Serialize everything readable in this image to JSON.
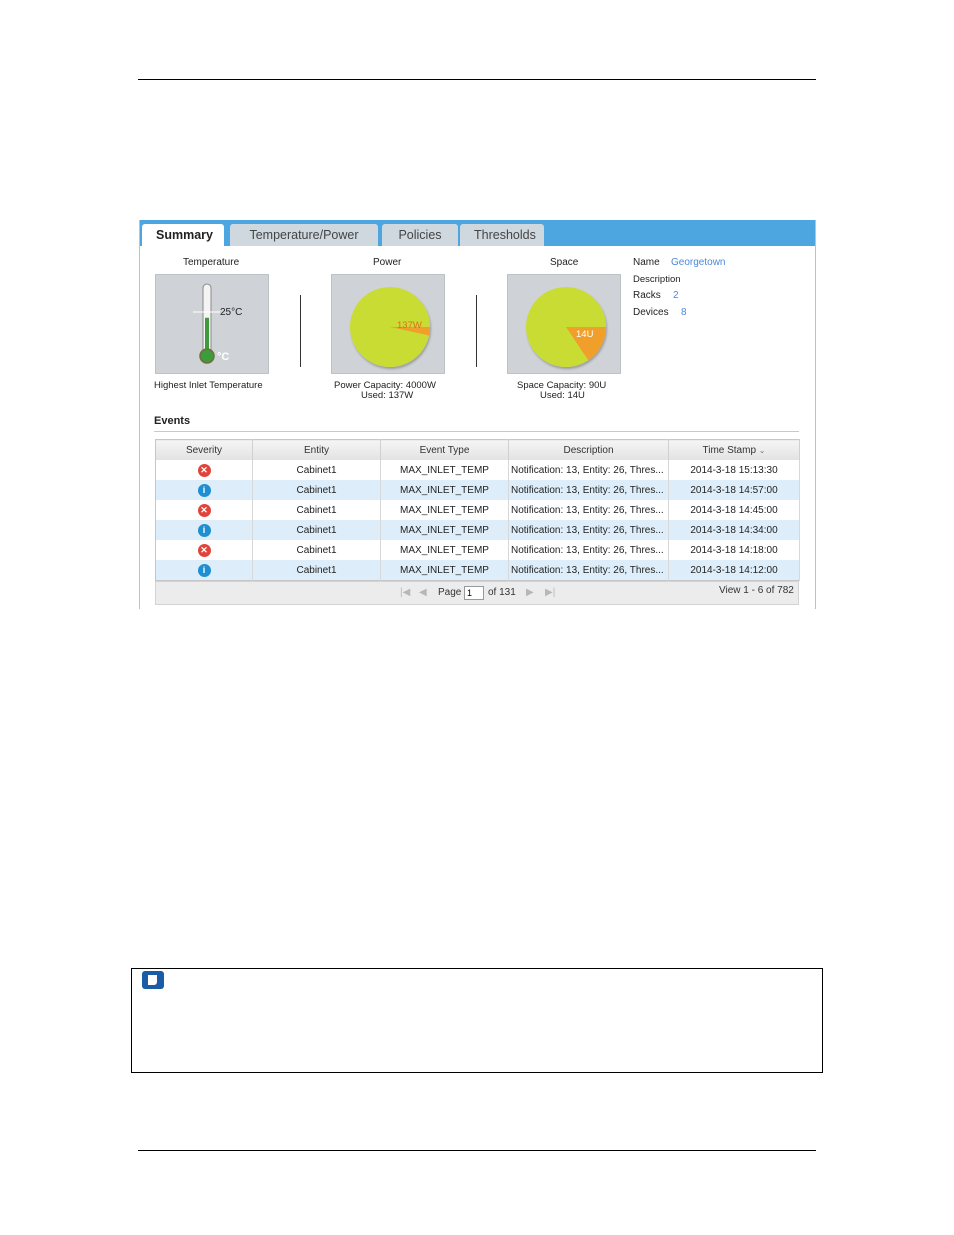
{
  "tabs": [
    "Summary",
    "Temperature/Power",
    "Policies",
    "Thresholds"
  ],
  "temperature": {
    "title": "Temperature",
    "value": "25°C",
    "unit": "°C",
    "caption": "Highest Inlet Temperature",
    "fraction": 0.55
  },
  "power": {
    "title": "Power",
    "value": "137W",
    "caption_1": "Power Capacity: 4000W",
    "caption_2": "Used: 137W",
    "used_fraction": 0.034
  },
  "space": {
    "title": "Space",
    "value": "14U",
    "caption_1": "Space Capacity: 90U",
    "caption_2": "Used: 14U",
    "used_fraction": 0.156
  },
  "info": {
    "name_label": "Name",
    "name_value": "Georgetown",
    "description_label": "Description",
    "racks_label": "Racks",
    "racks_value": "2",
    "devices_label": "Devices",
    "devices_value": "8"
  },
  "events": {
    "title": "Events",
    "columns": [
      "Severity",
      "Entity",
      "Event Type",
      "Description",
      "Time Stamp"
    ],
    "rows": [
      {
        "severity": "error",
        "entity": "Cabinet1",
        "type": "MAX_INLET_TEMP",
        "description": "Notification: 13, Entity: 26, Thres...",
        "timestamp": "2014-3-18 15:13:30"
      },
      {
        "severity": "info",
        "entity": "Cabinet1",
        "type": "MAX_INLET_TEMP",
        "description": "Notification: 13, Entity: 26, Thres...",
        "timestamp": "2014-3-18 14:57:00"
      },
      {
        "severity": "error",
        "entity": "Cabinet1",
        "type": "MAX_INLET_TEMP",
        "description": "Notification: 13, Entity: 26, Thres...",
        "timestamp": "2014-3-18 14:45:00"
      },
      {
        "severity": "info",
        "entity": "Cabinet1",
        "type": "MAX_INLET_TEMP",
        "description": "Notification: 13, Entity: 26, Thres...",
        "timestamp": "2014-3-18 14:34:00"
      },
      {
        "severity": "error",
        "entity": "Cabinet1",
        "type": "MAX_INLET_TEMP",
        "description": "Notification: 13, Entity: 26, Thres...",
        "timestamp": "2014-3-18 14:18:00"
      },
      {
        "severity": "info",
        "entity": "Cabinet1",
        "type": "MAX_INLET_TEMP",
        "description": "Notification: 13, Entity: 26, Thres...",
        "timestamp": "2014-3-18 14:12:00"
      }
    ],
    "pager": {
      "page_label": "Page",
      "page_value": "1",
      "of_label": "of 131",
      "view_label": "View 1 - 6 of 782"
    }
  },
  "colors": {
    "tab_bar": "#4ea6e0",
    "pie_fill": "#c9dc34",
    "pie_used": "#f0a02a",
    "thermo_fill": "#3d9a3d",
    "link": "#4a8ad6",
    "note_icon": "#1a5ca6"
  }
}
